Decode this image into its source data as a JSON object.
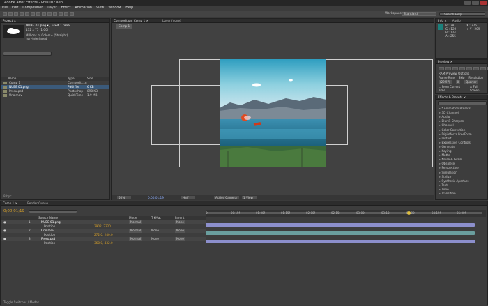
{
  "app": {
    "title": "Adobe After Effects - Presu02.aep"
  },
  "menu": [
    "File",
    "Edit",
    "Composition",
    "Layer",
    "Effect",
    "Animation",
    "View",
    "Window",
    "Help"
  ],
  "toolbar": {
    "workspace_label": "Workspace:",
    "workspace_value": "Standard",
    "search_placeholder": "Search Help"
  },
  "project": {
    "tab": "Project ×",
    "selected_name": "NUBE 01.png ▾ , used 1 time",
    "selected_dims": "132 x 75 (1.00)",
    "selected_colors": "Millions of Colors+ (Straight)",
    "selected_interlace": "non-interlaced",
    "columns": {
      "name": "Name",
      "type": "Type",
      "size": "Size"
    },
    "items": [
      {
        "name": "Comp 1",
        "type": "Compositi...n",
        "size": ""
      },
      {
        "name": "NUBE 01.png",
        "type": "PNG file",
        "size": "6 KB"
      },
      {
        "name": "Presu.psd",
        "type": "Photoshop",
        "size": "898 KB"
      },
      {
        "name": "Uno.mov",
        "type": "QuickTime",
        "size": "1.9 MB"
      }
    ],
    "footer": "8 bpc"
  },
  "viewer": {
    "tabs": [
      "Composition: Comp 1 ×",
      "Layer (none)"
    ],
    "comp_button": "Comp 1",
    "zoom": "50%",
    "timecode": "0;00;01;19",
    "resolution": "Half",
    "camera": "Active Camera",
    "views": "1 View"
  },
  "info": {
    "tabs": [
      "Info ×",
      "Audio"
    ],
    "r": "R : 28",
    "g": "G : 129",
    "b": "B : 124",
    "a": "A : 255",
    "x": "X : 376",
    "y": "+ Y : 209"
  },
  "preview": {
    "tab": "Preview ×",
    "ram": "RAM Preview Options",
    "frame_rate": "Frame Rate",
    "skip": "Skip",
    "resolution": "Resolution",
    "frame_rate_val": "(29.97)",
    "skip_val": "0",
    "resolution_val": "Quarter",
    "from_current": "From Current Time",
    "full_screen": "Full Screen"
  },
  "effects": {
    "tab": "Effects & Presets ×",
    "search_placeholder": "",
    "items": [
      "* Animation Presets",
      "3D Channel",
      "Audio",
      "Blur & Sharpen",
      "Channel",
      "Color Correction",
      "Digieffects FreeForm",
      "Distort",
      "Expression Controls",
      "Generate",
      "Keying",
      "Matte",
      "Noise & Grain",
      "Obsolete",
      "Perspective",
      "Simulation",
      "Stylize",
      "Synthetic Aperture",
      "Text",
      "Time",
      "Transition"
    ]
  },
  "timeline": {
    "tabs": [
      "Comp 1 ×",
      "Render Queue"
    ],
    "timecode": "0;00;01;19",
    "columns": {
      "source": "Source Name",
      "mode": "Mode",
      "trkmat": "TrkMat",
      "parent": "Parent"
    },
    "layers": [
      {
        "num": "1",
        "name": "NUBE 01.png",
        "prop": "Position",
        "value": "2902, 2320",
        "mode": "Normal",
        "trkmat": "",
        "parent": "None"
      },
      {
        "num": "2",
        "name": "Uno.mov",
        "prop": "Position",
        "value": "272.0, 240.0",
        "mode": "Normal",
        "trkmat": "None",
        "parent": "None"
      },
      {
        "num": "3",
        "name": "Presu.psd",
        "prop": "Position",
        "value": "360.0, 432.0",
        "mode": "Normal",
        "trkmat": "None",
        "parent": "None"
      }
    ],
    "ruler": [
      "0f",
      "00:15f",
      "01:00f",
      "01:15f",
      "02:00f",
      "02:15f",
      "03:00f",
      "03:15f",
      "04:00f",
      "04:15f",
      "05:00f"
    ],
    "footer": "Toggle Switches / Modes"
  },
  "colors": {
    "accent": "#3b5a7a",
    "playhead": "#d03030",
    "bar_blue": "#8c8fcc",
    "bar_teal": "#6a9e9e"
  }
}
